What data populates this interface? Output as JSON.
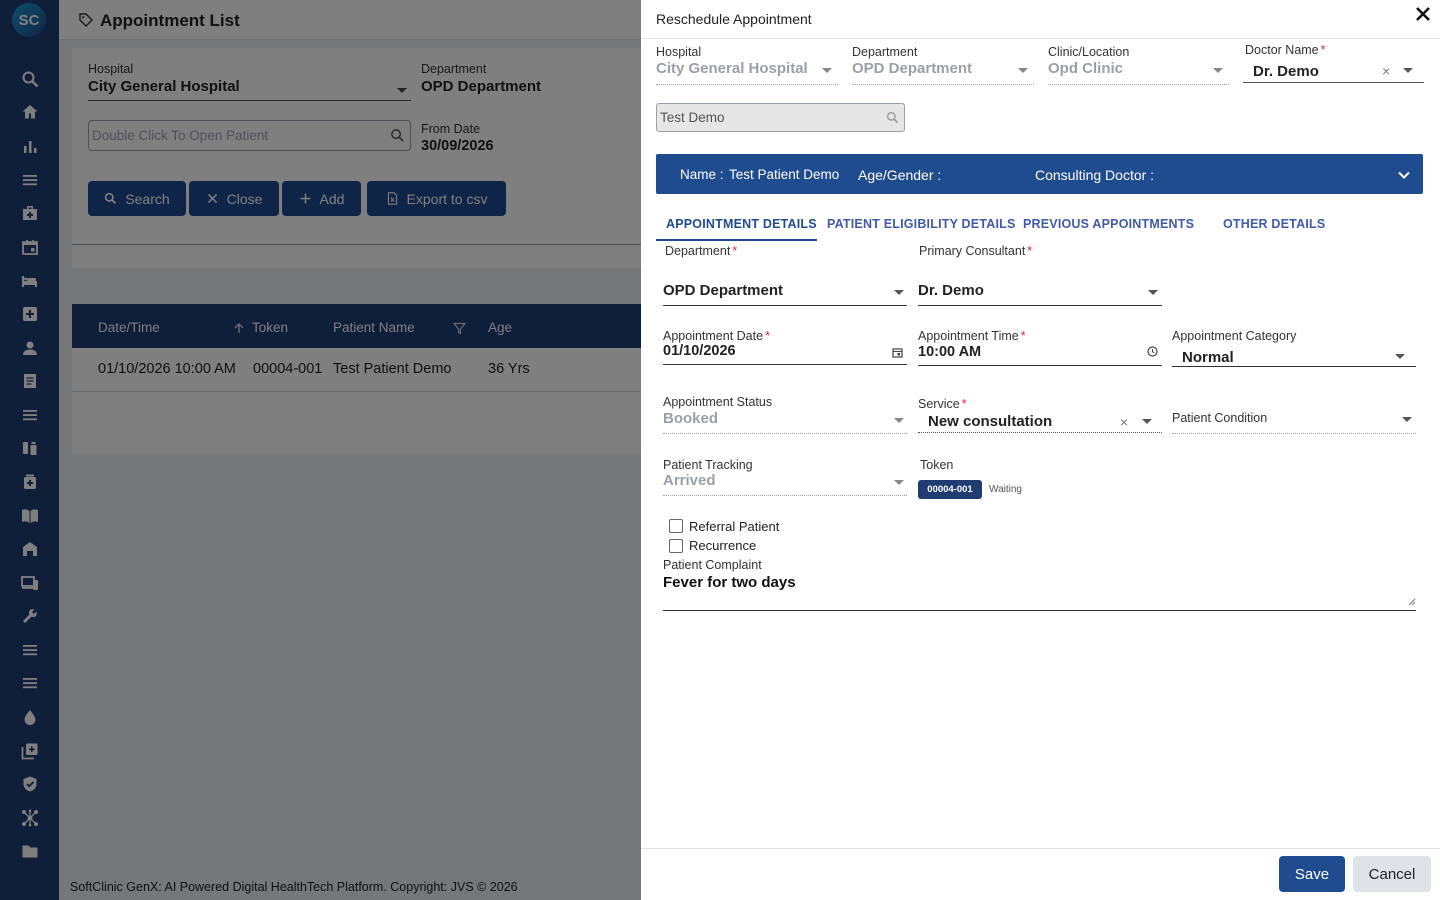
{
  "app": {
    "logo_text": "SC",
    "page_title": "Appointment List"
  },
  "sidebar": {
    "icons": [
      "search-icon",
      "home-icon",
      "bar-chart-icon",
      "menu-icon",
      "medical-bag-icon",
      "calendar-icon",
      "bed-icon",
      "hospital-plus-icon",
      "person-icon",
      "document-icon",
      "list-icon",
      "pharmacy-icon",
      "medicine-box-icon",
      "book-icon",
      "building-icon",
      "devices-icon",
      "wrench-icon",
      "menu-icon",
      "list-icon",
      "drop-icon",
      "add-box-icon",
      "shield-icon",
      "hub-icon",
      "folder-icon"
    ]
  },
  "filters": {
    "hospital_label": "Hospital",
    "hospital_value": "City General Hospital",
    "department_label": "Department",
    "department_value": "OPD Department",
    "patient_placeholder": "Double Click To Open Patient",
    "from_date_label": "From Date",
    "from_date_value": "30/09/2026"
  },
  "buttons": {
    "search": "Search",
    "close": "Close",
    "add": "Add",
    "export": "Export to csv"
  },
  "table": {
    "headers": [
      "Date/Time",
      "Token",
      "Patient Name",
      "Age"
    ],
    "rows": [
      {
        "datetime": "01/10/2026 10:00 AM",
        "token": "00004-001",
        "patient": "Test Patient Demo",
        "age": "36 Yrs"
      }
    ]
  },
  "footer": {
    "text": "SoftClinic GenX: AI Powered Digital HealthTech Platform. Copyright: JVS © 2026"
  },
  "dialog": {
    "title": "Reschedule Appointment",
    "hospital_label": "Hospital",
    "hospital_value": "City General Hospital",
    "department_label": "Department",
    "department_value": "OPD Department",
    "clinic_label": "Clinic/Location",
    "clinic_value": "Opd Clinic",
    "doctor_label": "Doctor Name",
    "doctor_value": "Dr. Demo",
    "search_value": "Test Demo",
    "info": {
      "name_label": "Name :",
      "name_value": "Test Patient Demo",
      "age_gender": "Age/Gender :",
      "consulting_doctor": "Consulting Doctor :"
    },
    "tabs": [
      "APPOINTMENT DETAILS",
      "PATIENT ELIGIBILITY DETAILS",
      "PREVIOUS APPOINTMENTS",
      "OTHER DETAILS"
    ],
    "form": {
      "department_label": "Department",
      "department_value": "OPD Department",
      "consultant_label": "Primary Consultant",
      "consultant_value": "Dr. Demo",
      "date_label": "Appointment Date",
      "date_value": "01/10/2026",
      "time_label": "Appointment Time",
      "time_value": "10:00 AM",
      "category_label": "Appointment Category",
      "category_value": "Normal",
      "status_label": "Appointment Status",
      "status_value": "Booked",
      "service_label": "Service",
      "service_value": "New consultation",
      "condition_label": "Patient Condition",
      "tracking_label": "Patient Tracking",
      "tracking_value": "Arrived",
      "token_label": "Token",
      "token_value": "00004-001",
      "token_status": "Waiting",
      "referral_label": "Referral Patient",
      "recurrence_label": "Recurrence",
      "complaint_label": "Patient Complaint",
      "complaint_value": "Fever for two days"
    },
    "save": "Save",
    "cancel": "Cancel"
  }
}
